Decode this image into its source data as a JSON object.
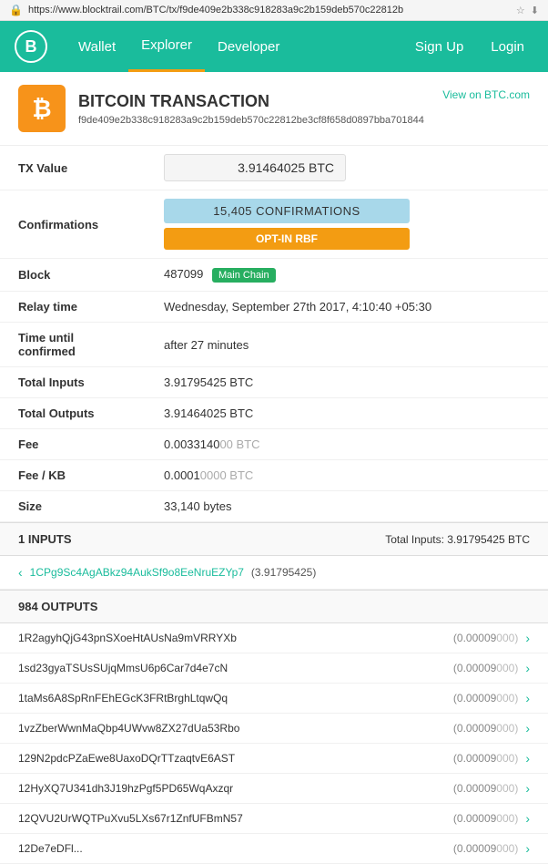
{
  "url": "https://www.blocktrail.com/BTC/tx/f9de409e2b338c918283a9c2b159deb570c22812b",
  "nav": {
    "logo": "B",
    "links": [
      "Wallet",
      "Explorer",
      "Developer"
    ],
    "active": "Explorer",
    "right": [
      "Sign Up",
      "Login"
    ]
  },
  "transaction": {
    "icon": "₿",
    "title": "BITCOIN TRANSACTION",
    "view_link": "View on BTC.com",
    "hash": "f9de409e2b338c918283a9c2b159deb570c22812be3cf8f658d0897bba701844",
    "tx_value": "3.91464025 BTC",
    "confirmations": "15,405 CONFIRMATIONS",
    "rbf_label": "OPT-IN RBF",
    "block_number": "487099",
    "block_badge": "Main Chain",
    "relay_time": "Wednesday, September 27th 2017, 4:10:40 +05:30",
    "time_until_confirmed": "after 27 minutes",
    "total_inputs": "3.91795425 BTC",
    "total_outputs": "3.91464025 BTC",
    "fee": "0.0033140",
    "fee_muted": "0 BTC",
    "fee_kb": "0.0001",
    "fee_kb_muted": "0000 BTC",
    "size": "33,140 bytes",
    "labels": {
      "tx_value": "TX Value",
      "confirmations": "Confirmations",
      "block": "Block",
      "relay_time": "Relay time",
      "time_until_confirmed": "Time until confirmed",
      "total_inputs": "Total Inputs",
      "total_outputs": "Total Outputs",
      "fee": "Fee",
      "fee_kb": "Fee / KB",
      "size": "Size"
    }
  },
  "inputs_section": {
    "header": "1 INPUTS",
    "total": "Total Inputs: 3.91795425 BTC",
    "items": [
      {
        "address": "1CPg9Sc4AgABkz94AukSf9o8EeNruEZYp7",
        "value": "(3.91795425)"
      }
    ]
  },
  "outputs_section": {
    "header": "984 OUTPUTS",
    "items": [
      {
        "address": "1R2agyhQjG43pnSXoeHtAUsNa9mVRRYXb",
        "value": "(0.00009",
        "muted": "000)"
      },
      {
        "address": "1sd23gyaTSUsSUjqMmsU6p6Car7d4e7cN",
        "value": "(0.00009",
        "muted": "000)"
      },
      {
        "address": "1taMs6A8SpRnFEhEGcK3FRtBrghLtqwQq",
        "value": "(0.00009",
        "muted": "000)"
      },
      {
        "address": "1vzZberWwnMaQbp4UWvw8ZX27dUa53Rbo",
        "value": "(0.00009",
        "muted": "000)"
      },
      {
        "address": "129N2pdcPZaEwe8UaxoDQrTTzaqtvE6AST",
        "value": "(0.00009",
        "muted": "000)"
      },
      {
        "address": "12HyXQ7U341dh3J19hzPgf5PD65WqAxzqr",
        "value": "(0.00009",
        "muted": "000)"
      },
      {
        "address": "12QVU2UrWQTPuXvu5LXs67r1ZnfUFBmN57",
        "value": "(0.00009",
        "muted": "000)"
      },
      {
        "address": "12De7eDFl...",
        "value": "(0.00009",
        "muted": "000)"
      }
    ]
  }
}
